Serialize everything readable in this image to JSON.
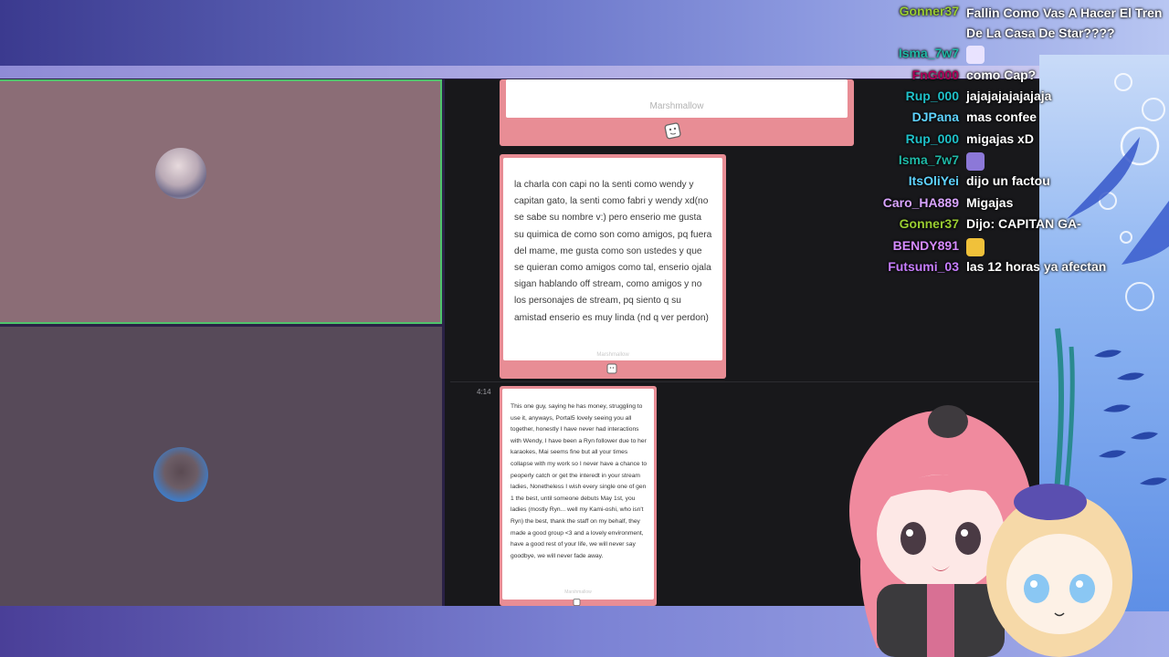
{
  "cards": {
    "card1": {
      "label": "Marshmallow"
    },
    "card2": {
      "text": "la charla con capi no la senti como wendy y capitan gato, la senti como fabri y wendy xd(no se sabe su nombre v:) pero enserio me gusta su quimica de como son como amigos, pq fuera del mame, me gusta como son ustedes y que se quieran como amigos como tal, enserio ojala sigan hablando off stream, como amigos y no los personajes de stream, pq siento q su amistad enserio es muy linda (nd q ver perdon)",
      "label": "Marshmallow"
    },
    "card3": {
      "text": "This one guy, saying he has money, struggling to use it, anyways, Portal5 lovely seeing you all together, honestly I have never had interactions with Wendy, I have been a Ryn follower due to her karaokes, Mai seems fine but all your times collapse with my work so I never have a chance to peoperly catch or get the interedt in your stream ladies, Nonetheless I wish every single one of gen 1 the best, until someone debuts May 1st, you ladies (mostly Ryn... well my Kami-oshi, who isn't Ryn) the best, thank the staff on my behalf, they made a good group <3 and a lovely environment, have a good rest of your life, we will never say goodbye, we will never fade away.",
      "label": "Marshmallow"
    }
  },
  "timestamp": "4:14",
  "chat": [
    {
      "user": "Gonner37",
      "color": "#9acd32",
      "msg": "Fallin Como Vas A Hacer El Tren De La Casa De Star????"
    },
    {
      "user": "Isma_7w7",
      "color": "#1fb8a6",
      "msg": "",
      "emote": "glasses-face-emote"
    },
    {
      "user": "FnG000",
      "color": "#b0005a",
      "msg": "como Cap?"
    },
    {
      "user": "Rup_000",
      "color": "#1fc0c8",
      "msg": "jajajajajajajaja"
    },
    {
      "user": "DJPana",
      "color": "#5fd3ff",
      "msg": "mas confee"
    },
    {
      "user": "Rup_000",
      "color": "#1fc0c8",
      "msg": "migajas xD"
    },
    {
      "user": "Isma_7w7",
      "color": "#1fb8a6",
      "msg": "",
      "emote": "purple-character-emote"
    },
    {
      "user": "ItsOliYei",
      "color": "#5fd3ff",
      "msg": "dijo un factou"
    },
    {
      "user": "Caro_HA889",
      "color": "#d9a4ff",
      "msg": "Migajas"
    },
    {
      "user": "Gonner37",
      "color": "#9acd32",
      "msg": "Dijo: CAPITAN GA-"
    },
    {
      "user": "BENDY891",
      "color": "#d68bff",
      "msg": "",
      "emote": "yellow-cat-emote"
    },
    {
      "user": "Futsumi_03",
      "color": "#c77dff",
      "msg": "las 12 horas ya afectan"
    }
  ],
  "colors": {
    "card_pink": "#e88d95",
    "browser_bg": "#18181b",
    "cam_border": "#4fc36b"
  }
}
